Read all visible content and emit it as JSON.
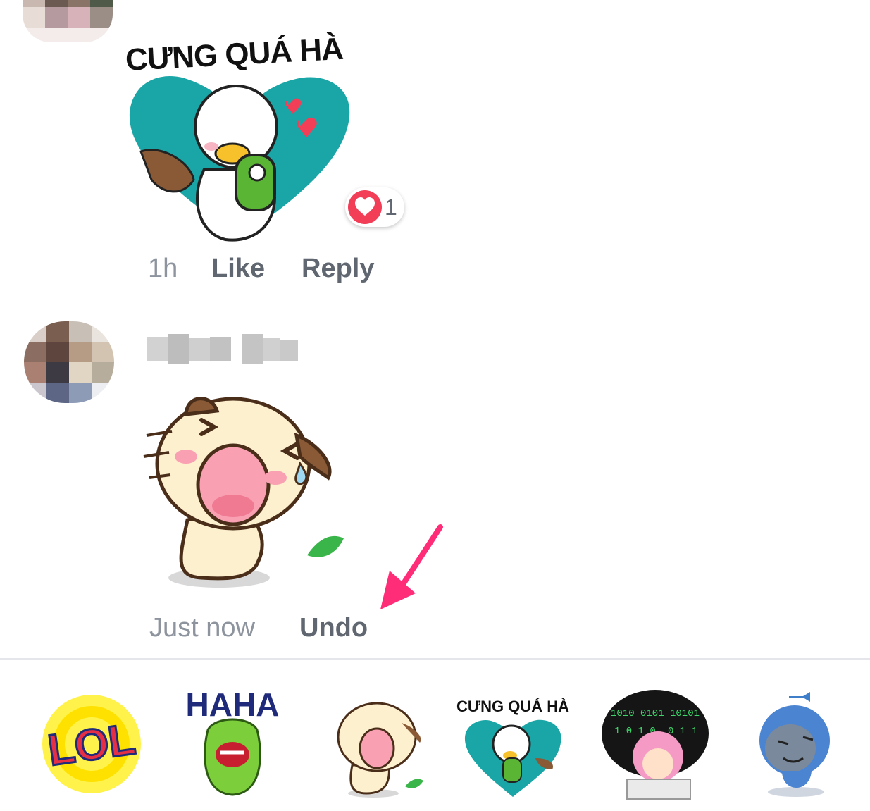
{
  "comment1": {
    "sticker_text": "CƯNG QUÁ HÀ",
    "sticker_name": "duck-heart-sticker",
    "reaction": {
      "icon": "love-reaction-icon",
      "count": "1"
    },
    "time": "1h",
    "like_label": "Like",
    "reply_label": "Reply"
  },
  "comment2": {
    "sticker_name": "laughing-cat-sticker",
    "time": "Just now",
    "undo_label": "Undo"
  },
  "colors": {
    "teal": "#1aa6a6",
    "reaction_red": "#f33e58",
    "arrow_pink": "#ff2d78",
    "action_gray": "#606770",
    "meta_gray": "#8d949e"
  },
  "tray": {
    "items": [
      {
        "name": "lol-sticker",
        "text": "LOL"
      },
      {
        "name": "haha-ghost-sticker",
        "text": "HAHA"
      },
      {
        "name": "laughing-cat-sticker"
      },
      {
        "name": "cung-qua-ha-sticker",
        "text": "CƯNG QUÁ HÀ"
      },
      {
        "name": "binary-girl-sticker",
        "text": "1010 0101 10101"
      },
      {
        "name": "blue-bird-sticker"
      }
    ]
  }
}
